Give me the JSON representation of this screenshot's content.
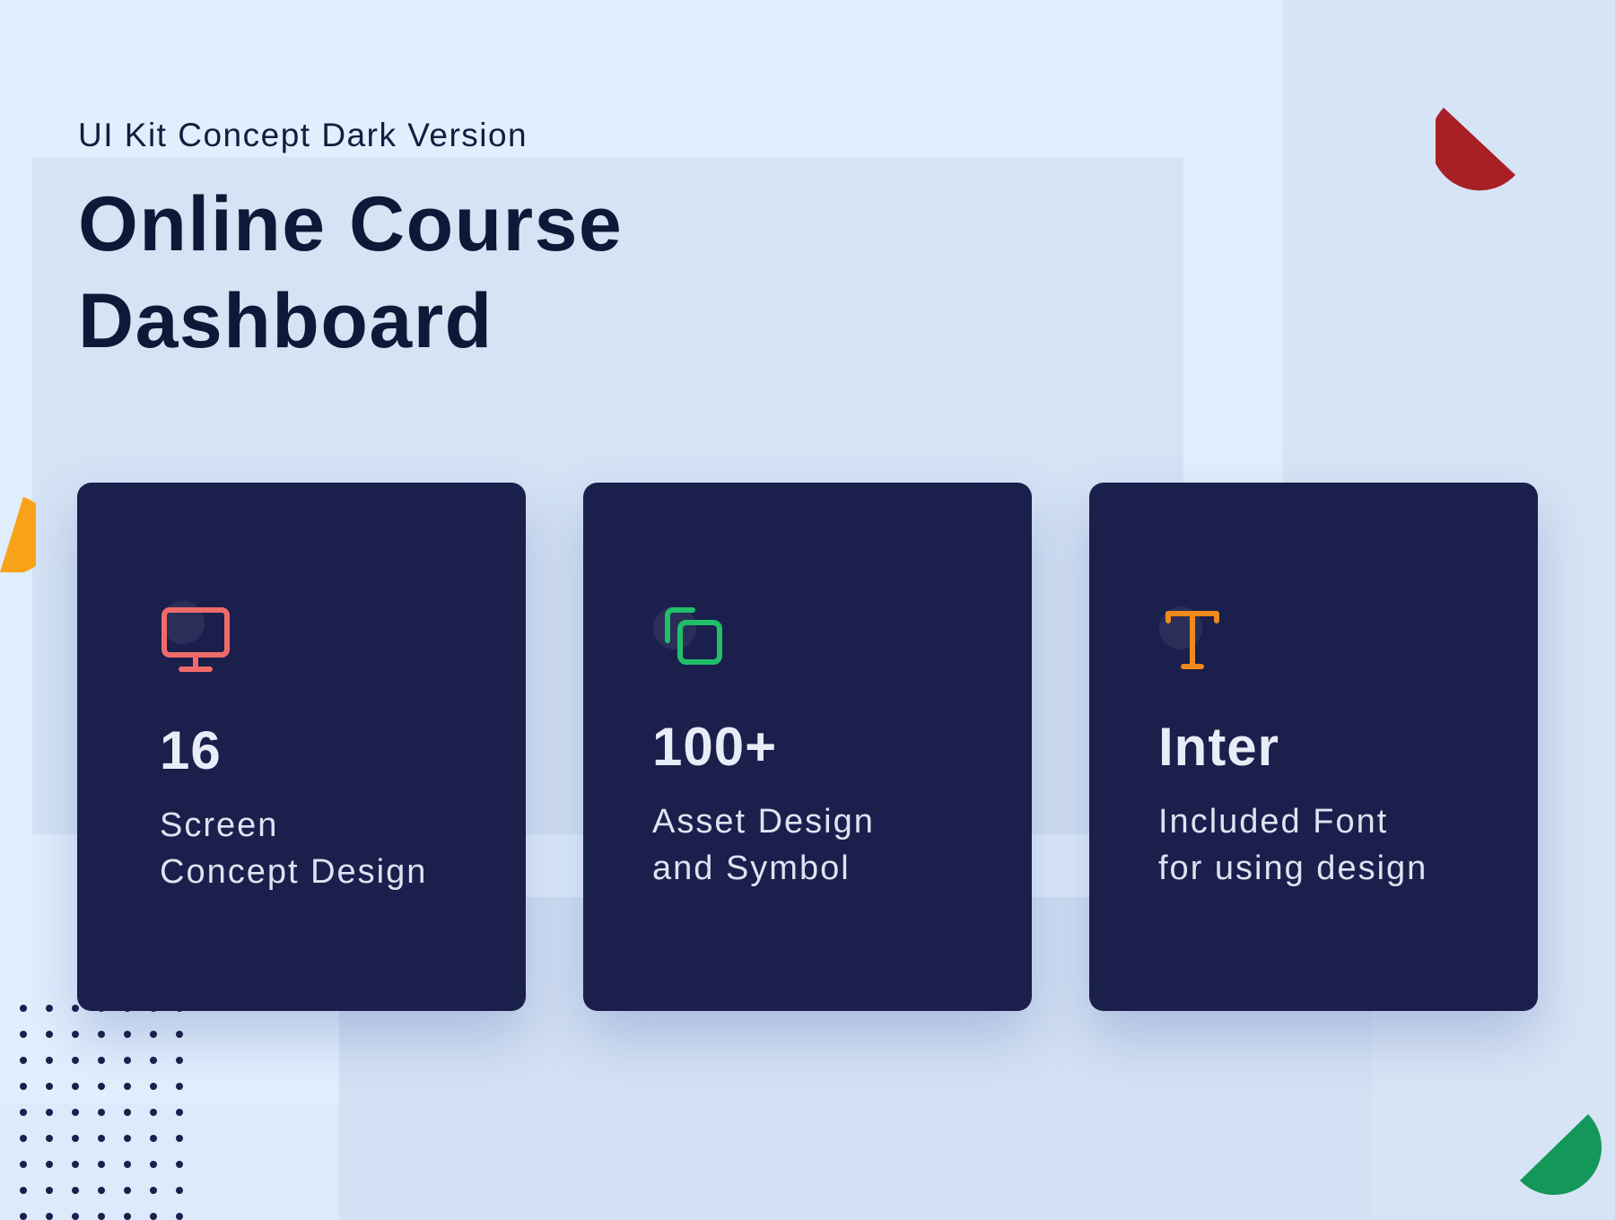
{
  "header": {
    "subtitle": "UI Kit Concept Dark Version",
    "title_line1": "Online Course",
    "title_line2": "Dashboard"
  },
  "cards": [
    {
      "icon": "monitor-icon",
      "color": "#f06a6a",
      "value": "16",
      "line1": "Screen",
      "line2": "Concept Design"
    },
    {
      "icon": "copy-icon",
      "color": "#1fbf6a",
      "value": "100+",
      "line1": "Asset Design",
      "line2": "and Symbol"
    },
    {
      "icon": "type-icon",
      "color": "#f08a1c",
      "value": "Inter",
      "line1": "Included Font",
      "line2": "for using design"
    }
  ],
  "colors": {
    "background": "#e1eefd",
    "card": "#1a1f4c",
    "title": "#0f1838",
    "deco_red": "#a82026",
    "deco_orange": "#f8a21a",
    "deco_green": "#14985a"
  }
}
